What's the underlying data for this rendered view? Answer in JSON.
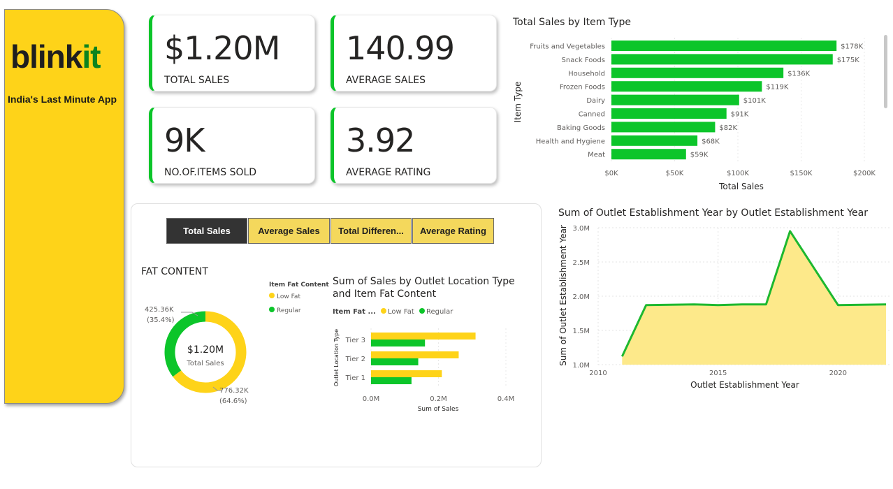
{
  "brand": {
    "logo_main": "blink",
    "logo_accent": "it",
    "tagline": "India's Last Minute App"
  },
  "kpis": [
    {
      "value": "$1.20M",
      "label": "TOTAL SALES"
    },
    {
      "value": "140.99",
      "label": "AVERAGE SALES"
    },
    {
      "value": "9K",
      "label": "NO.OF.ITEMS SOLD"
    },
    {
      "value": "3.92",
      "label": "AVERAGE RATING"
    }
  ],
  "tabs": [
    {
      "label": "Total Sales",
      "active": true
    },
    {
      "label": "Average Sales",
      "active": false
    },
    {
      "label": "Total Differen...",
      "active": false
    },
    {
      "label": "Average Rating",
      "active": false
    }
  ],
  "colors": {
    "accent_green": "#0cc52a",
    "accent_yellow": "#fed319",
    "area_fill": "#fde98a",
    "line_green": "#1db82f"
  },
  "chart_data": [
    {
      "type": "bar",
      "orientation": "horizontal",
      "title": "Total Sales by Item Type",
      "xlabel": "Total Sales",
      "ylabel": "Item Type",
      "categories": [
        "Fruits and Vegetables",
        "Snack Foods",
        "Household",
        "Frozen Foods",
        "Dairy",
        "Canned",
        "Baking Goods",
        "Health and Hygiene",
        "Meat"
      ],
      "values": [
        178,
        175,
        136,
        119,
        101,
        91,
        82,
        68,
        59
      ],
      "data_labels": [
        "$178K",
        "$175K",
        "$136K",
        "$119K",
        "$101K",
        "$91K",
        "$82K",
        "$68K",
        "$59K"
      ],
      "xticks": [
        "$0K",
        "$50K",
        "$100K",
        "$150K",
        "$200K"
      ],
      "xlim": [
        0,
        200
      ],
      "unit": "K"
    },
    {
      "type": "pie",
      "variant": "donut",
      "title": "FAT CONTENT",
      "legend_title": "Item Fat Content",
      "center_value": "$1.20M",
      "center_label": "Total Sales",
      "slices": [
        {
          "name": "Low Fat",
          "value": 776.32,
          "label": "776.32K",
          "pct": "(64.6%)",
          "color": "#fed319"
        },
        {
          "name": "Regular",
          "value": 425.36,
          "label": "425.36K",
          "pct": "(35.4%)",
          "color": "#0cc52a"
        }
      ]
    },
    {
      "type": "bar",
      "orientation": "horizontal",
      "title": "Sum of Sales by Outlet Location Type and Item Fat Content",
      "title_line1": "Sum of Sales by Outlet Location Type",
      "title_line2": "and Item Fat Content",
      "legend_title": "Item Fat ...",
      "xlabel": "Sum of Sales",
      "ylabel": "Outlet Location Type",
      "categories": [
        "Tier 3",
        "Tier 2",
        "Tier 1"
      ],
      "xticks": [
        "0.0M",
        "0.2M",
        "0.4M"
      ],
      "xlim": [
        0,
        0.4
      ],
      "series": [
        {
          "name": "Low Fat",
          "color": "#fed319",
          "values": [
            0.31,
            0.26,
            0.21
          ]
        },
        {
          "name": "Regular",
          "color": "#0cc52a",
          "values": [
            0.16,
            0.14,
            0.12
          ]
        }
      ]
    },
    {
      "type": "area",
      "title": "Sum of Outlet Establishment Year by Outlet Establishment Year",
      "xlabel": "Outlet Establishment Year",
      "ylabel": "Sum of Outlet Establishment Year",
      "x": [
        2011,
        2012,
        2014,
        2015,
        2016,
        2017,
        2018,
        2020,
        2022
      ],
      "y": [
        1.12,
        1.87,
        1.88,
        1.87,
        1.88,
        1.88,
        2.95,
        1.87,
        1.88
      ],
      "xlim": [
        2010,
        2022
      ],
      "ylim": [
        1.0,
        3.0
      ],
      "xticks": [
        "2010",
        "2015",
        "2020"
      ],
      "yticks": [
        "3.0M",
        "2.5M",
        "2.0M",
        "1.5M",
        "1.0M"
      ]
    }
  ]
}
